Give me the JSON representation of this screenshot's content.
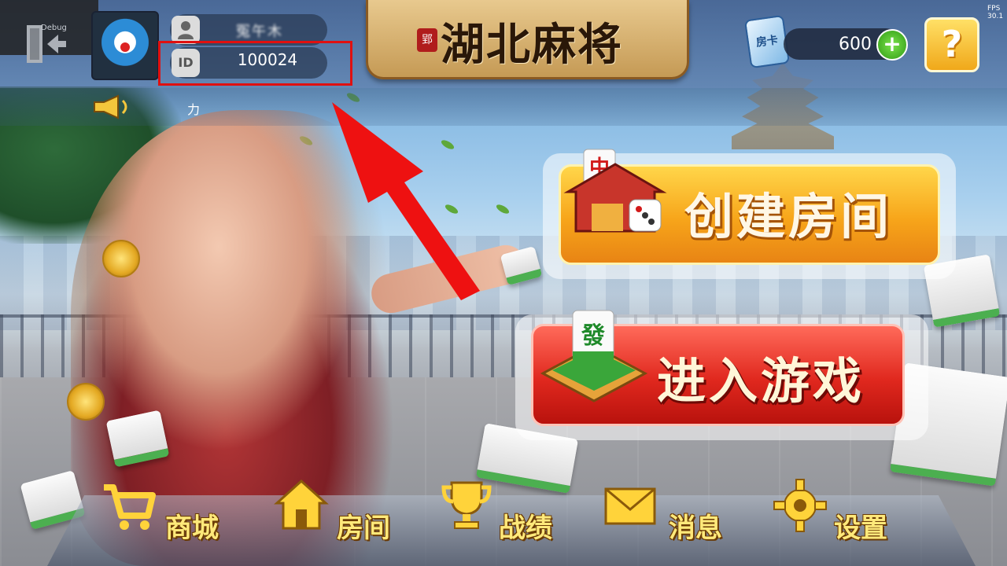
{
  "window": {
    "fps_label": "FPS",
    "fps_value": "30.1"
  },
  "debug": {
    "label": "Debug",
    "icon": "exit-icon"
  },
  "profile": {
    "name_blurred": "冤午木",
    "id_badge": "ID",
    "id_value": "100024"
  },
  "title": {
    "seal": "郢",
    "text": "湖北麻将"
  },
  "currency": {
    "card_icon_text": "房卡",
    "balance": "600",
    "add_label": "+"
  },
  "help": {
    "label": "?"
  },
  "notice": {
    "ticker_text": "力"
  },
  "actions": {
    "create_room": "创建房间",
    "create_tile_char": "中",
    "enter_game": "进入游戏",
    "enter_tile_char": "發"
  },
  "nav": {
    "items": [
      {
        "label": "商城",
        "icon": "shop-cart-icon"
      },
      {
        "label": "房间",
        "icon": "house-icon"
      },
      {
        "label": "战绩",
        "icon": "trophy-icon"
      },
      {
        "label": "消息",
        "icon": "mail-icon"
      },
      {
        "label": "设置",
        "icon": "gear-icon"
      }
    ]
  },
  "colors": {
    "highlight": "#e01010",
    "arrow": "#ee1111",
    "accent_gold": "#ffe97a"
  }
}
